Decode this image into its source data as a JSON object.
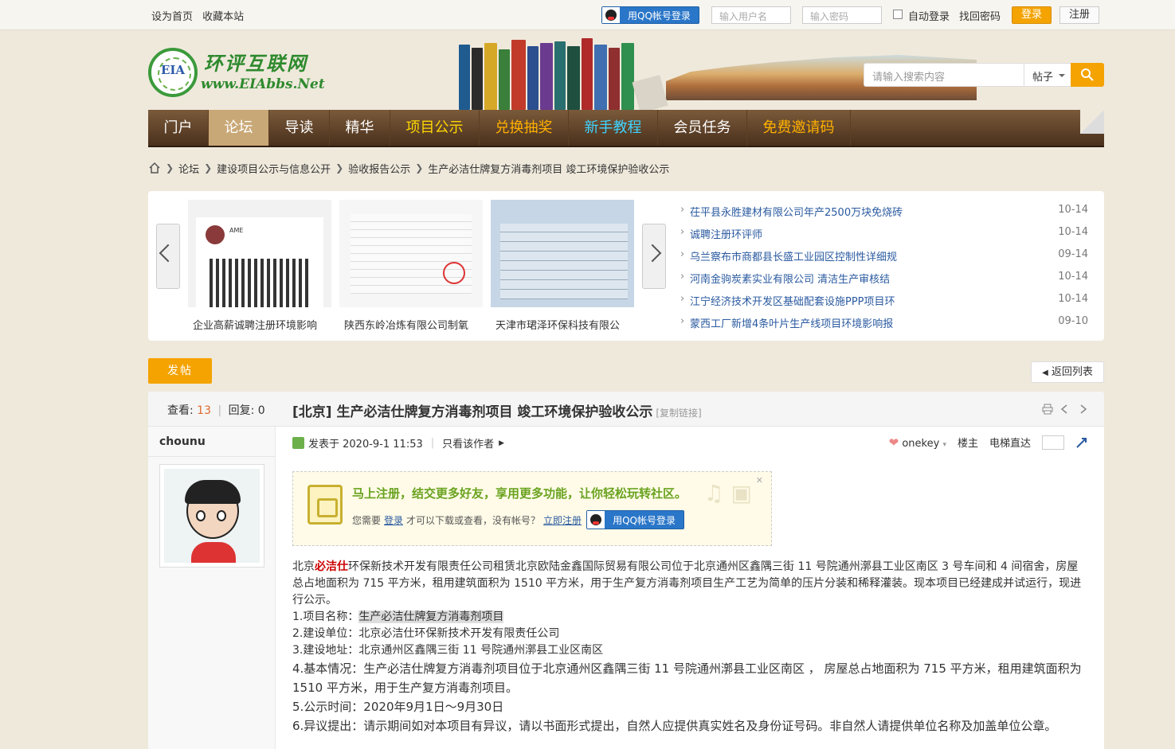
{
  "topbar": {
    "set_home": "设为首页",
    "bookmark": "收藏本站",
    "qq_login": "用QQ帐号登录",
    "username_placeholder": "输入用户名",
    "password_placeholder": "输入密码",
    "auto_login": "自动登录",
    "find_password": "找回密码",
    "login": "登录",
    "register": "注册"
  },
  "logo": {
    "name": "环评互联网",
    "url": "www.EIAbbs.Net",
    "badge": "EIA"
  },
  "search": {
    "placeholder": "请输入搜索内容",
    "scope": "帖子"
  },
  "nav": [
    "门户",
    "论坛",
    "导读",
    "精华",
    "项目公示",
    "兑换抽奖",
    "新手教程",
    "会员任务",
    "免费邀请码"
  ],
  "nav_colors": [
    "#ffffff",
    "#ffffff",
    "#ffffff",
    "#ffffff",
    "#ffd700",
    "#ffb000",
    "#3ed3ff",
    "#ffffff",
    "#ffb000"
  ],
  "breadcrumb": [
    "论坛",
    "建设项目公示与信息公开",
    "验收报告公示",
    "生产必洁仕牌复方消毒剂项目 竣工环境保护验收公示"
  ],
  "slides": [
    {
      "caption": "企业高薪诚聘注册环境影响"
    },
    {
      "caption": "陕西东岭冶炼有限公司制氧"
    },
    {
      "caption": "天津市珺泽环保科技有限公"
    }
  ],
  "hot_threads": [
    {
      "title": "茌平县永胜建材有限公司年产2500万块免烧砖",
      "date": "10-14"
    },
    {
      "title": "诚聘注册环评师",
      "date": "10-14"
    },
    {
      "title": "乌兰察布市商都县长盛工业园区控制性详细规",
      "date": "09-14"
    },
    {
      "title": "河南金驹炭素实业有限公司 清洁生产审核结",
      "date": "10-14"
    },
    {
      "title": "江宁经济技术开发区基础配套设施PPP项目环",
      "date": "10-14"
    },
    {
      "title": "蒙西工厂新增4条叶片生产线项目环境影响报",
      "date": "09-10"
    }
  ],
  "actions": {
    "post": "发帖",
    "back": "返回列表"
  },
  "thread": {
    "views_label": "查看:",
    "views": "13",
    "replies_label": "回复:",
    "replies": "0",
    "title": "[北京] 生产必洁仕牌复方消毒剂项目 竣工环境保护验收公示",
    "copy_link": "[复制链接]",
    "author": "chounu",
    "posted": "发表于 2020-9-1 11:53",
    "only_author": "只看该作者",
    "user": "onekey",
    "floor": "楼主",
    "elevator": "电梯直达"
  },
  "notice": {
    "headline": "马上注册，结交更多好友，享用更多功能，让你轻松玩转社区。",
    "need": "您需要",
    "login": "登录",
    "middle": "才可以下载或查看，没有帐号？",
    "register": "立即注册",
    "qq_login": "用QQ帐号登录"
  },
  "content": {
    "p1_a": "北京",
    "p1_red": "必洁仕",
    "p1_b": "环保新技术开发有限责任公司租赁北京欧陆金鑫国际贸易有限公司位于北京通州区鑫隅三街 11 号院通州漷县工业区南区 3 号车间和 4 间宿舍，房屋总占地面积为 715 平方米，租用建筑面积为 1510 平方米，用于生产复方消毒剂项目生产工艺为简单的压片分装和稀释灌装。现本项目已经建成并试运行，现进行公示。",
    "l1_label": "1.项目名称：",
    "l1_value": "生产必洁仕牌复方消毒剂项目",
    "l2": "2.建设单位：北京必洁仕环保新技术开发有限责任公司",
    "l3": "3.建设地址：北京通州区鑫隅三街 11 号院通州漷县工业区南区",
    "l4": "4.基本情况：生产必洁仕牌复方消毒剂项目位于北京通州区鑫隅三街 11 号院通州漷县工业区南区 ， 房屋总占地面积为 715 平方米，租用建筑面积为 1510 平方米，用于生产复方消毒剂项目。",
    "l5": "5.公示时间：2020年9月1日～9月30日",
    "l6": "6.异议提出：请示期间如对本项目有异议，请以书面形式提出，自然人应提供真实姓名及身份证号码。非自然人请提供单位名称及加盖单位公章。"
  }
}
